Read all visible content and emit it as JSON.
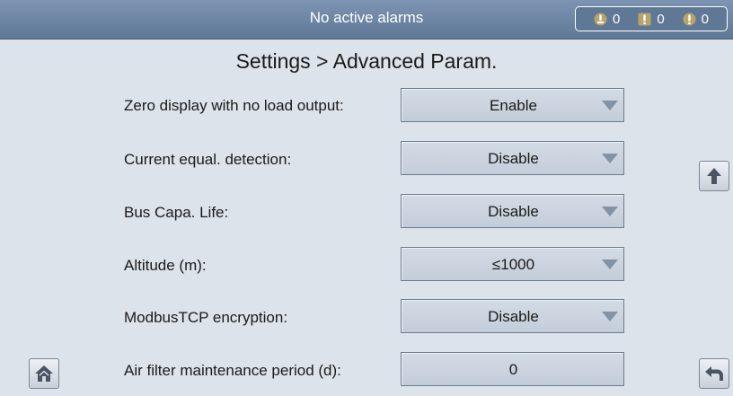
{
  "header": {
    "alarm_status": "No active alarms",
    "counts": [
      {
        "icon": "minor-alarm-icon",
        "value": "0"
      },
      {
        "icon": "major-alarm-icon",
        "value": "0"
      },
      {
        "icon": "critical-alarm-icon",
        "value": "0"
      }
    ]
  },
  "page": {
    "title": "Settings > Advanced Param."
  },
  "settings": [
    {
      "label": "Zero display with no load output:",
      "value": "Enable",
      "type": "dropdown"
    },
    {
      "label": "Current equal. detection:",
      "value": "Disable",
      "type": "dropdown"
    },
    {
      "label": "Bus Capa. Life:",
      "value": "Disable",
      "type": "dropdown"
    },
    {
      "label": "Altitude (m):",
      "value": "≤1000",
      "type": "dropdown"
    },
    {
      "label": "ModbusTCP encryption:",
      "value": "Disable",
      "type": "dropdown"
    },
    {
      "label": "Air filter maintenance period (d):",
      "value": "0",
      "type": "input"
    }
  ],
  "nav": {
    "home_icon": "home-icon",
    "up_icon": "arrow-up-icon",
    "back_icon": "back-arrow-icon"
  },
  "colors": {
    "header_bg": "#6f88a7",
    "page_bg": "#dde3ea",
    "field_bg": "#c8d2de"
  }
}
